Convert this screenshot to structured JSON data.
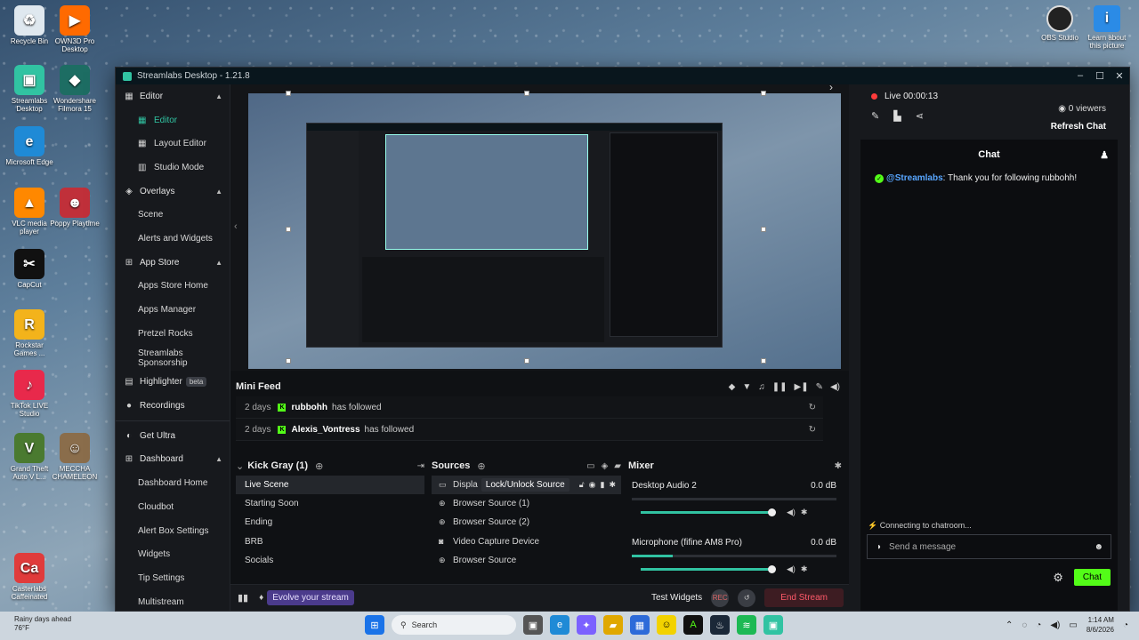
{
  "desktop": {
    "left_icons": [
      {
        "label": "Recycle Bin",
        "icon": "recycle-bin-icon",
        "color": "#dfe8ef",
        "glyph": "♻"
      },
      {
        "label": "OWN3D Pro Desktop",
        "icon": "own3d-icon",
        "color": "#ff6a00",
        "glyph": "▶"
      },
      {
        "label": "Streamlabs Desktop",
        "icon": "streamlabs-icon",
        "color": "#31c3a2",
        "glyph": "▣"
      },
      {
        "label": "Wondershare Filmora 15",
        "icon": "filmora-icon",
        "color": "#1d6d63",
        "glyph": "◆"
      },
      {
        "label": "Microsoft Edge",
        "icon": "edge-icon",
        "color": "#1f8ad6",
        "glyph": "e"
      },
      {
        "label": "VLC media player",
        "icon": "vlc-icon",
        "color": "#ff8800",
        "glyph": "▲"
      },
      {
        "label": "Poppy Playtime",
        "icon": "poppy-icon",
        "color": "#c0303a",
        "glyph": "☻"
      },
      {
        "label": "CapCut",
        "icon": "capcut-icon",
        "color": "#111111",
        "glyph": "✂"
      },
      {
        "label": "Rockstar Games ...",
        "icon": "rockstar-icon",
        "color": "#f3b31b",
        "glyph": "R"
      },
      {
        "label": "TikTok LIVE Studio",
        "icon": "tiktok-icon",
        "color": "#e8294b",
        "glyph": "♪"
      },
      {
        "label": "Grand Theft Auto V L...",
        "icon": "gta-icon",
        "color": "#4a7a30",
        "glyph": "V"
      },
      {
        "label": "MECCHA CHAMELEON",
        "icon": "meccha-icon",
        "color": "#8a6d4b",
        "glyph": "☺"
      },
      {
        "label": "Casterlabs Caffeinated",
        "icon": "casterlabs-icon",
        "color": "#e03b3b",
        "glyph": "Ca"
      }
    ],
    "right_icons": [
      {
        "label": "OBS Studio",
        "icon": "obs-icon"
      },
      {
        "label": "Learn about this picture",
        "icon": "learn-picture-icon"
      }
    ]
  },
  "window": {
    "title": "Streamlabs Desktop - 1.21.8"
  },
  "sidebar": {
    "sections": [
      {
        "label": "Editor",
        "icon": "editor-icon",
        "items": [
          {
            "label": "Editor",
            "icon": "editor-grid-icon",
            "active": true
          },
          {
            "label": "Layout Editor",
            "icon": "layout-icon"
          },
          {
            "label": "Studio Mode",
            "icon": "studio-mode-icon"
          }
        ]
      },
      {
        "label": "Overlays",
        "icon": "overlays-icon",
        "items": [
          {
            "label": "Scene"
          },
          {
            "label": "Alerts and Widgets"
          }
        ]
      },
      {
        "label": "App Store",
        "icon": "app-store-icon",
        "items": [
          {
            "label": "Apps Store Home"
          },
          {
            "label": "Apps Manager"
          },
          {
            "label": "Pretzel Rocks"
          },
          {
            "label": "Streamlabs Sponsorship"
          }
        ]
      }
    ],
    "highlighter": "Highlighter",
    "highlighter_badge": "beta",
    "recordings": "Recordings",
    "get_ultra": "Get Ultra",
    "dashboard": "Dashboard",
    "dashboard_items": [
      "Dashboard Home",
      "Cloudbot",
      "Alert Box Settings",
      "Widgets",
      "Tip Settings",
      "Multistream"
    ]
  },
  "mini_feed": {
    "title": "Mini Feed",
    "rows": [
      {
        "age": "2 days",
        "user": "rubbohh",
        "action": "has followed"
      },
      {
        "age": "2 days",
        "user": "Alexis_Vontress",
        "action": "has followed"
      }
    ]
  },
  "scenes": {
    "title": "Kick Gray (1)",
    "items": [
      "Live Scene",
      "Starting Soon",
      "Ending",
      "BRB",
      "Socials"
    ],
    "selected": 0
  },
  "sources": {
    "title": "Sources",
    "items": [
      {
        "label": "Displa",
        "icon": "monitor-icon",
        "tooltip": "Lock/Unlock Source"
      },
      {
        "label": "Browser Source (1)",
        "icon": "globe-icon"
      },
      {
        "label": "Browser Source (2)",
        "icon": "globe-icon"
      },
      {
        "label": "Video Capture Device",
        "icon": "camera-icon"
      },
      {
        "label": "Browser Source",
        "icon": "globe-icon"
      }
    ]
  },
  "mixer": {
    "title": "Mixer",
    "channels": [
      {
        "name": "Desktop Audio 2",
        "db": "0.0 dB",
        "level": 0.0,
        "volume": 1.0
      },
      {
        "name": "Microphone (fifine AM8 Pro)",
        "db": "0.0 dB",
        "level": 0.2,
        "volume": 1.0
      }
    ]
  },
  "footer": {
    "evolve": "Evolve your stream",
    "test_widgets": "Test Widgets",
    "end_stream": "End Stream"
  },
  "chat_panel": {
    "live_label": "Live 00:00:13",
    "viewers": "0 viewers",
    "refresh": "Refresh Chat",
    "chat_title": "Chat",
    "message_user": "@Streamlabs",
    "message_text": ": Thank you for following rubbohh!",
    "connecting": "Connecting to chatroom...",
    "input_placeholder": "Send a message",
    "chat_button": "Chat"
  },
  "taskbar": {
    "weather_title": "Rainy days ahead",
    "weather_temp": "76°F",
    "search_placeholder": "Search",
    "time": "1:14 AM",
    "date": "8/6/2026"
  },
  "colors": {
    "accent": "#31c3a2",
    "kick_green": "#53fc18",
    "live_red": "#ff3b3b",
    "end_stream_text": "#ff5a6a"
  }
}
